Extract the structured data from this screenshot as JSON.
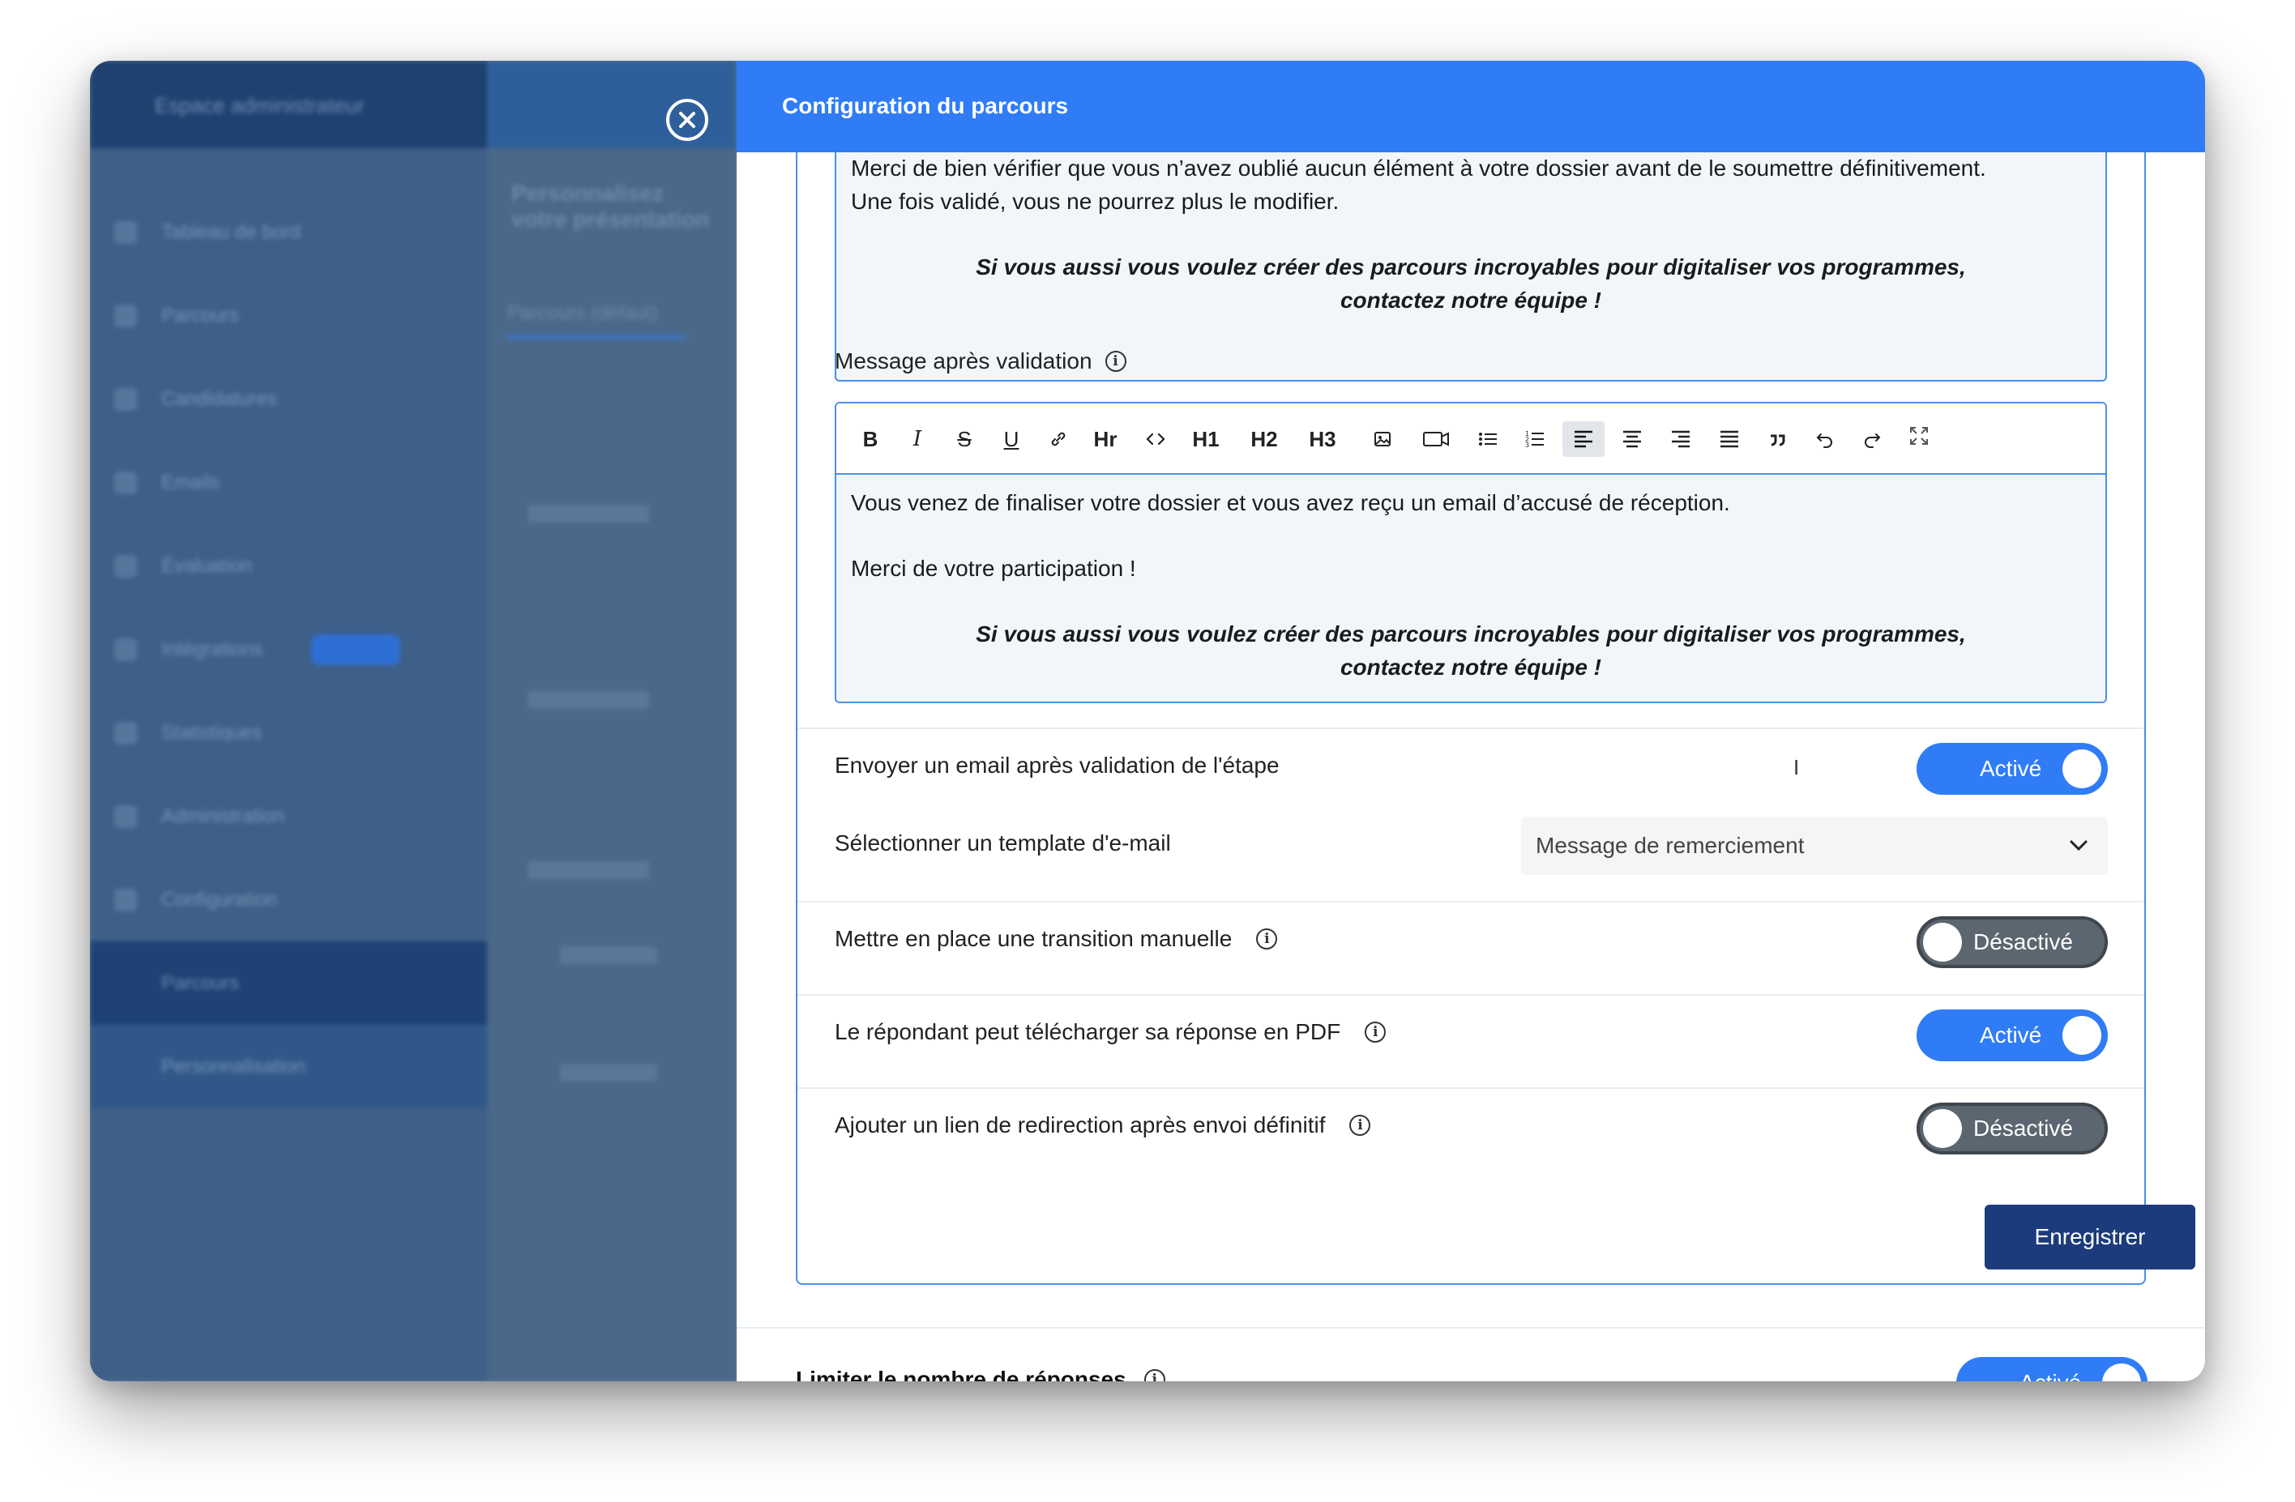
{
  "panel": {
    "title": "Configuration du parcours",
    "close_icon": "close-circle-icon"
  },
  "background_app": {
    "brand": "Espace administrateur",
    "menu": [
      "Tableau de bord",
      "Parcours",
      "Candidatures",
      "Emails",
      "Évaluation",
      "Intégrations",
      "Statistiques",
      "Administration",
      "Configuration",
      "Parcours",
      "Personnalisation"
    ],
    "page_title": "Personnalisez votre présentation",
    "tab": "Parcours (défaut)"
  },
  "previous_editor": {
    "line1": "Merci de bien vérifier que vous n’avez oublié aucun élément à votre dossier avant de le soumettre définitivement.",
    "line2": "Une fois validé, vous ne pourrez plus le modifier.",
    "em_line1": "Si vous aussi vous voulez créer des parcours incroyables pour digitaliser vos programmes,",
    "em_line2": "contactez notre équipe !"
  },
  "validation_message": {
    "label": "Message après validation",
    "toolbar": {
      "bold": "B",
      "italic": "I",
      "strike": "S",
      "underline": "U",
      "hr": "Hr",
      "h1": "H1",
      "h2": "H2",
      "h3": "H3"
    },
    "body_line1": "Vous venez de finaliser votre dossier et vous avez reçu un email d’accusé de réception.",
    "body_line2": "Merci de votre participation !",
    "em_line1": "Si vous aussi vous voulez créer des parcours incroyables pour digitaliser vos programmes,",
    "em_line2": "contactez notre équipe !"
  },
  "settings": {
    "send_email": {
      "label": "Envoyer un email après validation de l'étape",
      "state": "Activé",
      "on": true
    },
    "template": {
      "label": "Sélectionner un template d'e-mail",
      "value": "Message de remerciement"
    },
    "manual_transition": {
      "label": "Mettre en place une transition manuelle",
      "state": "Désactivé",
      "on": false
    },
    "pdf_download": {
      "label": "Le répondant peut télécharger sa réponse en PDF",
      "state": "Activé",
      "on": true
    },
    "redirect_link": {
      "label": "Ajouter un lien de redirection après envoi définitif",
      "state": "Désactivé",
      "on": false
    }
  },
  "save_label": "Enregistrer",
  "limit_responses": {
    "label": "Limiter le nombre de réponses",
    "state": "Activé"
  },
  "colors": {
    "accent": "#2f7cf6",
    "primary_dark": "#1c3b7d",
    "toggle_off": "#5c6670"
  }
}
